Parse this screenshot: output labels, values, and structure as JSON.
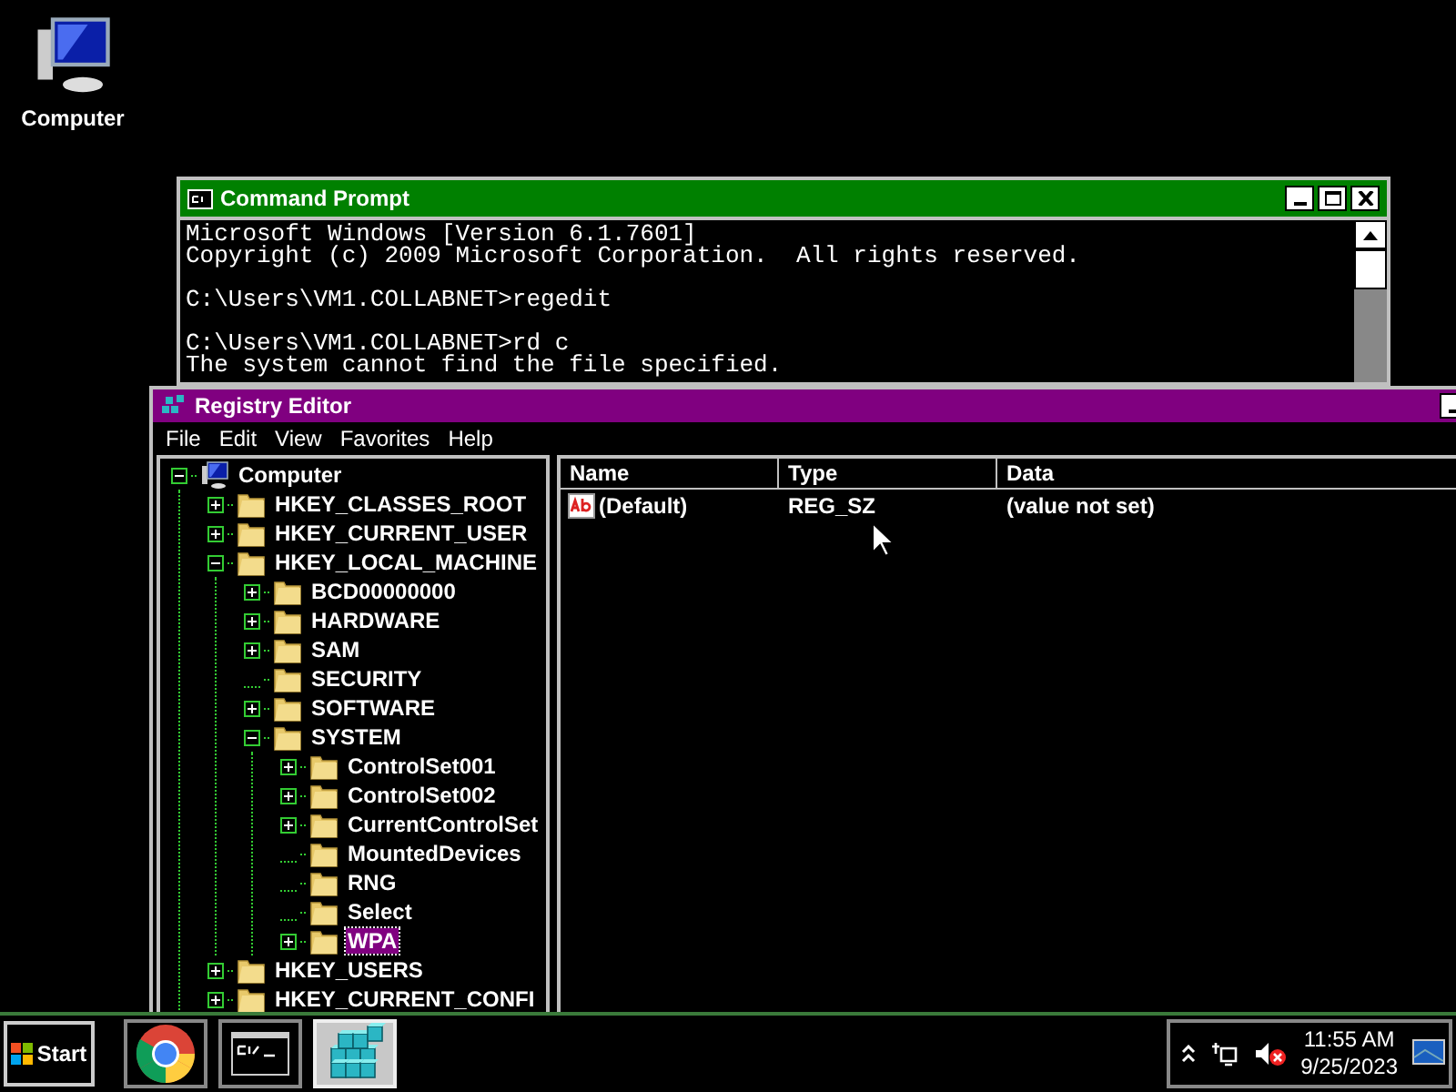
{
  "desktop_icons": [
    {
      "label": "Computer"
    }
  ],
  "command_prompt": {
    "title": "Command Prompt",
    "output_blocks": [
      [
        "Microsoft Windows [Version 6.1.7601]",
        "Copyright (c) 2009 Microsoft Corporation.  All rights reserved."
      ],
      [
        "C:\\Users\\VM1.COLLABNET>regedit"
      ],
      [
        "C:\\Users\\VM1.COLLABNET>rd c",
        "The system cannot find the file specified."
      ]
    ]
  },
  "registry_editor": {
    "title": "Registry Editor",
    "menu": [
      "File",
      "Edit",
      "View",
      "Favorites",
      "Help"
    ],
    "tree": [
      {
        "label": "Computer",
        "kind": "expanded",
        "selected": false,
        "children": [
          {
            "label": "HKEY_CLASSES_ROOT",
            "kind": "collapsed",
            "selected": false
          },
          {
            "label": "HKEY_CURRENT_USER",
            "kind": "collapsed",
            "selected": false
          },
          {
            "label": "HKEY_LOCAL_MACHINE",
            "kind": "expanded",
            "selected": false,
            "children": [
              {
                "label": "BCD00000000",
                "kind": "collapsed",
                "selected": false
              },
              {
                "label": "HARDWARE",
                "kind": "collapsed",
                "selected": false
              },
              {
                "label": "SAM",
                "kind": "collapsed",
                "selected": false
              },
              {
                "label": "SECURITY",
                "kind": "leaf",
                "selected": false
              },
              {
                "label": "SOFTWARE",
                "kind": "collapsed",
                "selected": false
              },
              {
                "label": "SYSTEM",
                "kind": "expanded",
                "selected": false,
                "children": [
                  {
                    "label": "ControlSet001",
                    "kind": "collapsed",
                    "selected": false
                  },
                  {
                    "label": "ControlSet002",
                    "kind": "collapsed",
                    "selected": false
                  },
                  {
                    "label": "CurrentControlSet",
                    "kind": "collapsed",
                    "selected": false
                  },
                  {
                    "label": "MountedDevices",
                    "kind": "leaf",
                    "selected": false
                  },
                  {
                    "label": "RNG",
                    "kind": "leaf",
                    "selected": false
                  },
                  {
                    "label": "Select",
                    "kind": "leaf",
                    "selected": false
                  },
                  {
                    "label": "WPA",
                    "kind": "collapsed",
                    "selected": true
                  }
                ]
              }
            ]
          },
          {
            "label": "HKEY_USERS",
            "kind": "collapsed",
            "selected": false
          },
          {
            "label": "HKEY_CURRENT_CONFI",
            "kind": "collapsed",
            "selected": false
          }
        ]
      }
    ],
    "columns": [
      "Name",
      "Type",
      "Data"
    ],
    "rows": [
      {
        "name": "(Default)",
        "type": "REG_SZ",
        "data": "(value not set)"
      }
    ]
  },
  "taskbar": {
    "start": "Start",
    "apps": [
      {
        "kind": "chrome",
        "selected": false
      },
      {
        "kind": "console",
        "selected": false
      },
      {
        "kind": "registry",
        "selected": true
      }
    ],
    "clock": {
      "time": "11:55 AM",
      "date": "9/25/2023"
    }
  }
}
